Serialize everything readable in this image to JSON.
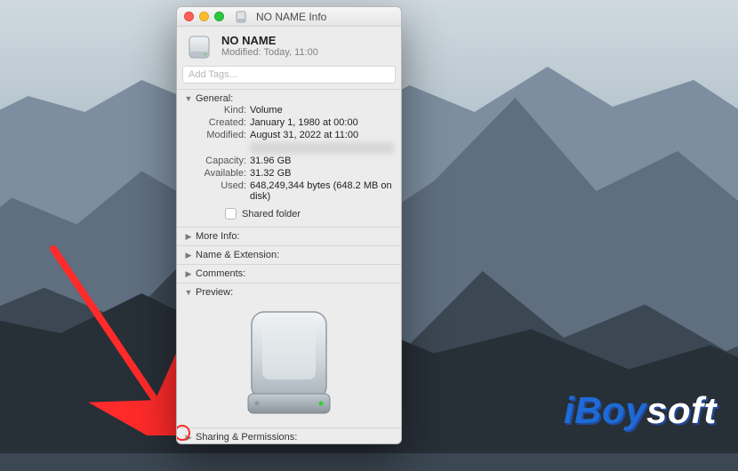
{
  "window": {
    "title": "NO NAME Info",
    "volumeName": "NO NAME",
    "modifiedSummary": "Modified: Today, 11:00",
    "tagsPlaceholder": "Add Tags..."
  },
  "sections": {
    "general": {
      "label": "General:",
      "rows": {
        "kind": {
          "k": "Kind:",
          "v": "Volume"
        },
        "created": {
          "k": "Created:",
          "v": "January 1, 1980 at 00:00"
        },
        "modified": {
          "k": "Modified:",
          "v": "August 31, 2022 at 11:00"
        },
        "hiddenLabel": "—",
        "capacity": {
          "k": "Capacity:",
          "v": "31.96 GB"
        },
        "available": {
          "k": "Available:",
          "v": "31.32 GB"
        },
        "used": {
          "k": "Used:",
          "v": "648,249,344 bytes (648.2 MB on disk)"
        }
      },
      "sharedFolderLabel": "Shared folder",
      "sharedFolderChecked": false
    },
    "moreInfo": "More Info:",
    "nameExt": "Name & Extension:",
    "comments": "Comments:",
    "preview": "Preview:",
    "sharing": "Sharing & Permissions:"
  },
  "watermark": {
    "accent": "iBoy",
    "rest": "soft"
  },
  "icons": {
    "triangleDown": "▼",
    "triangleRight": "▶"
  }
}
